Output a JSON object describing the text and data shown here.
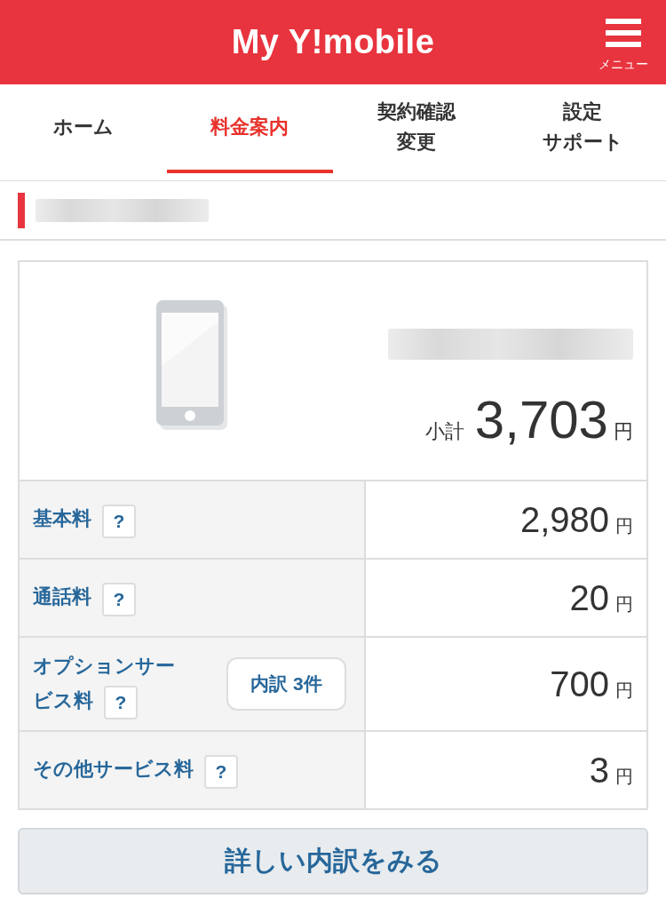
{
  "header": {
    "title": "My Y!mobile",
    "menu_label": "メニュー"
  },
  "tabs": [
    {
      "lines": [
        "ホーム"
      ],
      "selected": false
    },
    {
      "lines": [
        "料金案内"
      ],
      "selected": true
    },
    {
      "lines": [
        "契約確認",
        "変更"
      ],
      "selected": false
    },
    {
      "lines": [
        "設定",
        "サポート"
      ],
      "selected": false
    }
  ],
  "summary": {
    "subtotal_label": "小計",
    "amount": "3,703",
    "unit": "円"
  },
  "charges": [
    {
      "label_lines": [
        "基本料"
      ],
      "help": "?",
      "amount": "2,980",
      "unit": "円"
    },
    {
      "label_lines": [
        "通話料"
      ],
      "help": "?",
      "amount": "20",
      "unit": "円"
    },
    {
      "label_lines": [
        "オプションサー",
        "ビス料"
      ],
      "help": "?",
      "breakdown_button": "内訳 3件",
      "amount": "700",
      "unit": "円"
    },
    {
      "label_lines": [
        "その他サービス料"
      ],
      "help": "?",
      "amount": "3",
      "unit": "円"
    }
  ],
  "detail_button": "詳しい内訳をみる"
}
